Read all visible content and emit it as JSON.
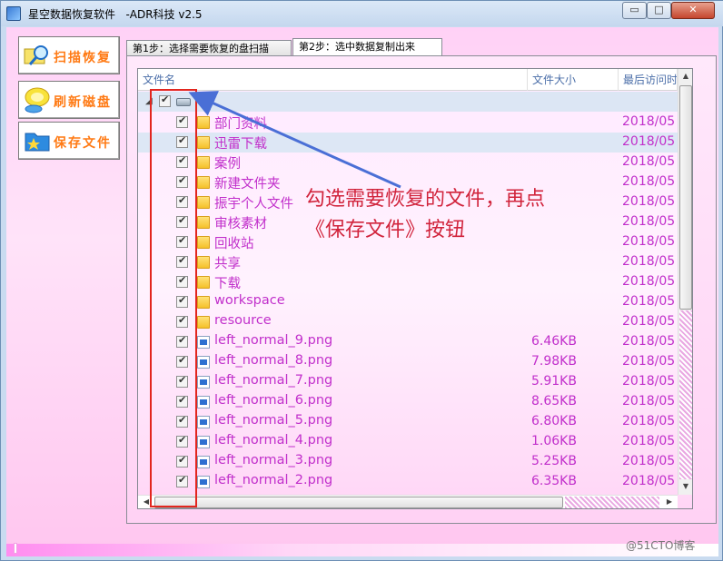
{
  "window": {
    "title": "星空数据恢复软件   -ADR科技 v2.5",
    "controls": {
      "minimize": "▭",
      "maximize": "□",
      "close": "✕"
    }
  },
  "sidebar": {
    "buttons": [
      {
        "label": "扫描恢复",
        "icon": "magnifier-icon"
      },
      {
        "label": "刷新磁盘",
        "icon": "refresh-disk-icon"
      },
      {
        "label": "保存文件",
        "icon": "save-folder-icon"
      }
    ]
  },
  "tabs": [
    {
      "label": "第1步：选择需要恢复的盘扫描",
      "active": false
    },
    {
      "label": "第2步：选中数据复制出来",
      "active": true
    }
  ],
  "list": {
    "columns": [
      "文件名",
      "文件大小",
      "最后访问时"
    ],
    "root": {
      "label": ":"
    },
    "rows": [
      {
        "name": "部门资料",
        "type": "folder",
        "size": "",
        "date": "2018/05"
      },
      {
        "name": "迅雷下载",
        "type": "folder",
        "size": "",
        "date": "2018/05",
        "selected": true
      },
      {
        "name": "案例",
        "type": "folder",
        "size": "",
        "date": "2018/05"
      },
      {
        "name": "新建文件夹",
        "type": "folder",
        "size": "",
        "date": "2018/05"
      },
      {
        "name": "振宇个人文件",
        "type": "folder",
        "size": "",
        "date": "2018/05"
      },
      {
        "name": "审核素材",
        "type": "folder",
        "size": "",
        "date": "2018/05"
      },
      {
        "name": "回收站",
        "type": "folder",
        "size": "",
        "date": "2018/05"
      },
      {
        "name": "共享",
        "type": "folder",
        "size": "",
        "date": "2018/05"
      },
      {
        "name": "下载",
        "type": "folder",
        "size": "",
        "date": "2018/05"
      },
      {
        "name": "workspace",
        "type": "folder",
        "size": "",
        "date": "2018/05"
      },
      {
        "name": "resource",
        "type": "folder",
        "size": "",
        "date": "2018/05"
      },
      {
        "name": "left_normal_9.png",
        "type": "file",
        "size": "6.46KB",
        "date": "2018/05"
      },
      {
        "name": "left_normal_8.png",
        "type": "file",
        "size": "7.98KB",
        "date": "2018/05"
      },
      {
        "name": "left_normal_7.png",
        "type": "file",
        "size": "5.91KB",
        "date": "2018/05"
      },
      {
        "name": "left_normal_6.png",
        "type": "file",
        "size": "8.65KB",
        "date": "2018/05"
      },
      {
        "name": "left_normal_5.png",
        "type": "file",
        "size": "6.80KB",
        "date": "2018/05"
      },
      {
        "name": "left_normal_4.png",
        "type": "file",
        "size": "1.06KB",
        "date": "2018/05"
      },
      {
        "name": "left_normal_3.png",
        "type": "file",
        "size": "5.25KB",
        "date": "2018/05"
      },
      {
        "name": "left_normal_2.png",
        "type": "file",
        "size": "6.35KB",
        "date": "2018/05"
      }
    ]
  },
  "annotation": {
    "line1": "勾选需要恢复的文件，再点",
    "line2": "《保存文件》按钮",
    "color": "#d1243c"
  },
  "watermark": "@51CTO博客",
  "colors": {
    "accent": "#c12fcb",
    "button_text": "#ff7a14",
    "annotation_box": "#e2261e",
    "arrow": "#4a6fd6"
  }
}
